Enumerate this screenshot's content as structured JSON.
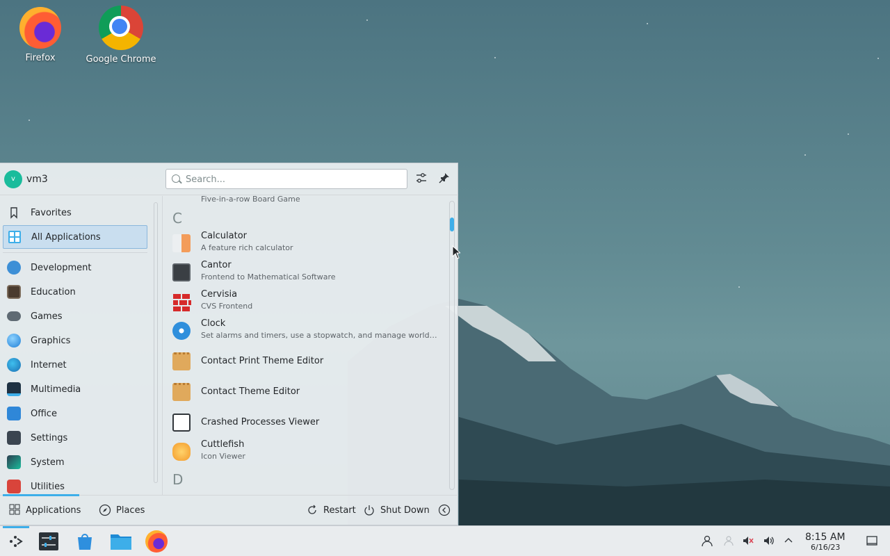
{
  "desktop": {
    "icons": [
      {
        "label": "Firefox",
        "icon": "firefox-icon"
      },
      {
        "label": "Google Chrome",
        "icon": "chrome-icon"
      }
    ]
  },
  "launcher": {
    "user": {
      "avatar_letter": "v",
      "name": "vm3"
    },
    "search": {
      "placeholder": "Search..."
    },
    "header_buttons": {
      "configure_icon": "sliders-icon",
      "pin_icon": "pin-icon"
    },
    "sidebar": {
      "top": [
        {
          "label": "Favorites",
          "icon": "bookmark-icon"
        },
        {
          "label": "All Applications",
          "icon": "grid-icon",
          "selected": true
        }
      ],
      "categories": [
        {
          "label": "Development",
          "icon": "development-icon"
        },
        {
          "label": "Education",
          "icon": "education-icon"
        },
        {
          "label": "Games",
          "icon": "gamepad-icon"
        },
        {
          "label": "Graphics",
          "icon": "graphics-icon"
        },
        {
          "label": "Internet",
          "icon": "globe-icon"
        },
        {
          "label": "Multimedia",
          "icon": "multimedia-icon"
        },
        {
          "label": "Office",
          "icon": "office-icon"
        },
        {
          "label": "Settings",
          "icon": "settings-icon"
        },
        {
          "label": "System",
          "icon": "system-icon"
        },
        {
          "label": "Utilities",
          "icon": "utilities-icon"
        }
      ]
    },
    "apps": {
      "partial_above": "Five-in-a-row Board Game",
      "section_c": "C",
      "items": [
        {
          "name": "Calculator",
          "desc": "A feature rich calculator"
        },
        {
          "name": "Cantor",
          "desc": "Frontend to Mathematical Software"
        },
        {
          "name": "Cervisia",
          "desc": "CVS Frontend"
        },
        {
          "name": "Clock",
          "desc": "Set alarms and timers, use a stopwatch, and manage world cloc..."
        },
        {
          "name": "Contact Print Theme Editor",
          "desc": ""
        },
        {
          "name": "Contact Theme Editor",
          "desc": ""
        },
        {
          "name": "Crashed Processes Viewer",
          "desc": ""
        },
        {
          "name": "Cuttlefish",
          "desc": "Icon Viewer"
        }
      ],
      "section_d": "D"
    },
    "footer": {
      "applications": "Applications",
      "places": "Places",
      "restart": "Restart",
      "shutdown": "Shut Down"
    }
  },
  "taskbar": {
    "clock": {
      "time": "8:15 AM",
      "date": "6/16/23"
    }
  },
  "colors": {
    "accent": "#3daee9",
    "selected_bg": "#c9deef"
  }
}
